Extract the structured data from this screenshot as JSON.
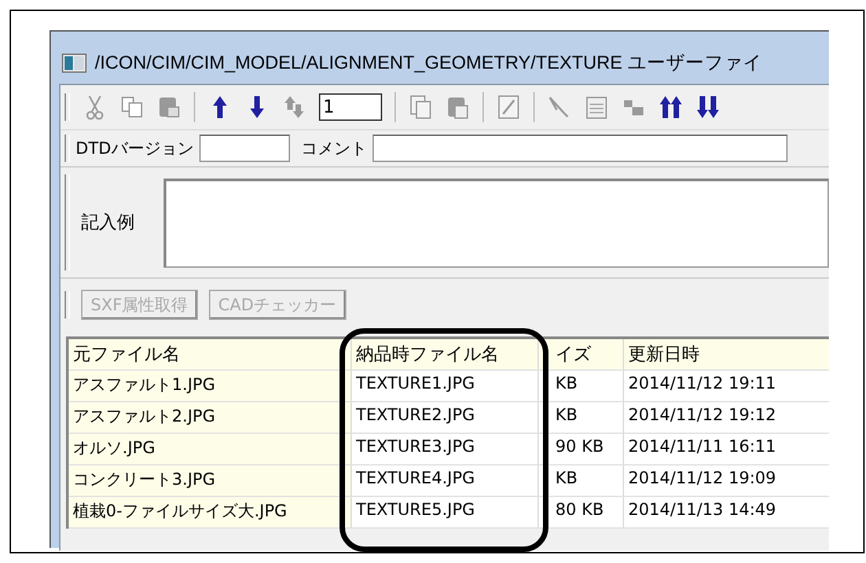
{
  "window": {
    "title": "/ICON/CIM/CIM_MODEL/ALIGNMENT_GEOMETRY/TEXTURE ユーザーファイ"
  },
  "toolbar": {
    "counter_value": "1"
  },
  "fields": [
    {
      "label": "DTDバージョン"
    },
    {
      "label": "コメント"
    }
  ],
  "example": {
    "label": "記入例"
  },
  "buttons": [
    {
      "label": "SXF属性取得",
      "disabled": true
    },
    {
      "label": "CADチェッカー",
      "disabled": true
    }
  ],
  "table": {
    "columns": [
      "元ファイル名",
      "納品時ファイル名",
      "イズ",
      "更新日時"
    ],
    "rows": [
      [
        "アスファルト1.JPG",
        "TEXTURE1.JPG",
        "KB",
        "2014/11/12 19:11"
      ],
      [
        "アスファルト2.JPG",
        "TEXTURE2.JPG",
        "KB",
        "2014/11/12 19:12"
      ],
      [
        "オルソ.JPG",
        "TEXTURE3.JPG",
        "90 KB",
        "2014/11/11 16:11"
      ],
      [
        "コンクリート3.JPG",
        "TEXTURE4.JPG",
        "KB",
        "2014/11/12 19:09"
      ],
      [
        "植栽0-ファイルサイズ大.JPG",
        "TEXTURE5.JPG",
        "80 KB",
        "2014/11/13 14:49"
      ]
    ]
  }
}
